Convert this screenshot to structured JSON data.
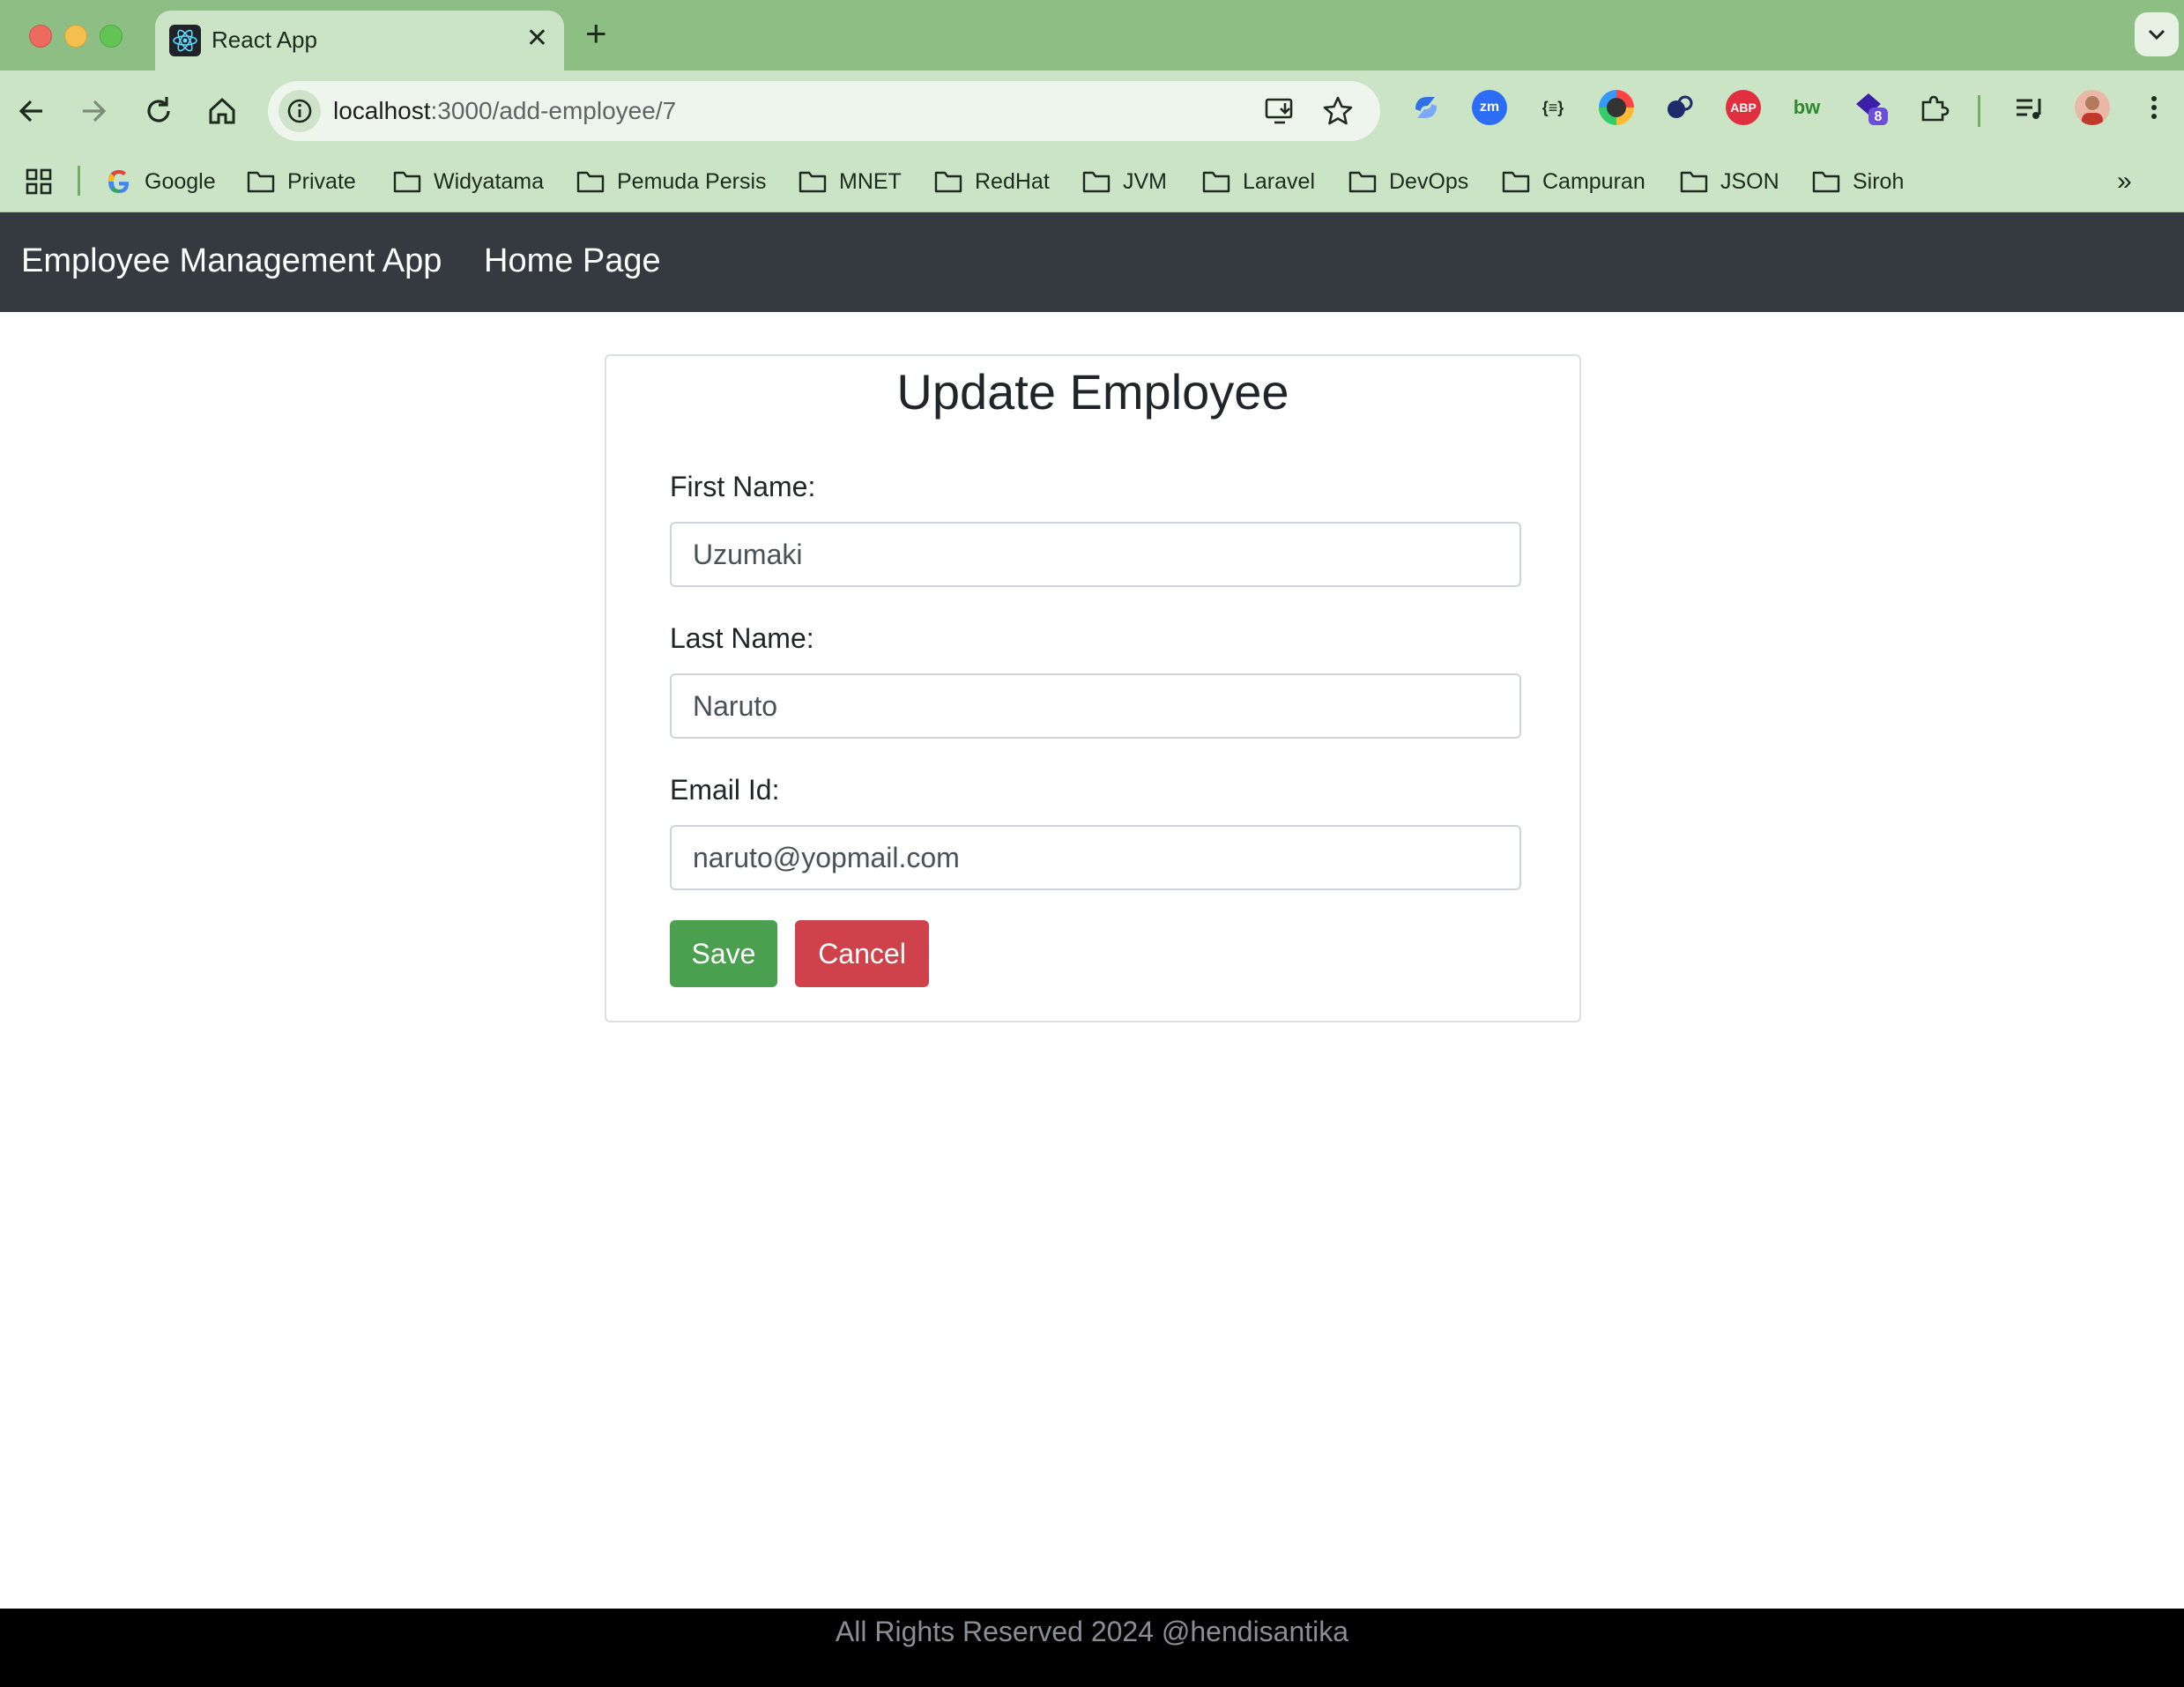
{
  "browser": {
    "tab_title": "React App",
    "url_host": "localhost",
    "url_path": ":3000/add-employee/7",
    "extension_badge": "8",
    "extensions": [
      {
        "name": "sync-icon",
        "color": "#4a8cf7",
        "label": ""
      },
      {
        "name": "zoom-icon",
        "color": "#2d6df6",
        "label": "zm"
      },
      {
        "name": "json-formatter-icon",
        "color": "transparent",
        "label": "{≡}"
      },
      {
        "name": "color-picker-icon",
        "color": "#444444",
        "label": ""
      },
      {
        "name": "seo-icon",
        "color": "#ffffff",
        "label": ""
      },
      {
        "name": "adblock-icon",
        "color": "#e0303f",
        "label": "ABP"
      },
      {
        "name": "bw-icon",
        "color": "transparent",
        "label": "bw"
      },
      {
        "name": "shortcut-icon",
        "color": "#3b1fa8",
        "label": ""
      }
    ],
    "bookmarks": [
      {
        "label": "Google",
        "type": "google"
      },
      {
        "label": "Private",
        "type": "folder"
      },
      {
        "label": "Widyatama",
        "type": "folder"
      },
      {
        "label": "Pemuda Persis",
        "type": "folder"
      },
      {
        "label": "MNET",
        "type": "folder"
      },
      {
        "label": "RedHat",
        "type": "folder"
      },
      {
        "label": "JVM",
        "type": "folder"
      },
      {
        "label": "Laravel",
        "type": "folder"
      },
      {
        "label": "DevOps",
        "type": "folder"
      },
      {
        "label": "Campuran",
        "type": "folder"
      },
      {
        "label": "JSON",
        "type": "folder"
      },
      {
        "label": "Siroh",
        "type": "folder"
      }
    ]
  },
  "app": {
    "brand": "Employee Management App",
    "nav_link": "Home Page",
    "form": {
      "title": "Update Employee",
      "first_name_label": "First Name:",
      "first_name_value": "Uzumaki",
      "last_name_label": "Last Name:",
      "last_name_value": "Naruto",
      "email_label": "Email Id:",
      "email_value": "naruto@yopmail.com",
      "save_label": "Save",
      "cancel_label": "Cancel"
    },
    "footer": "All Rights Reserved 2024 @hendisantika"
  }
}
